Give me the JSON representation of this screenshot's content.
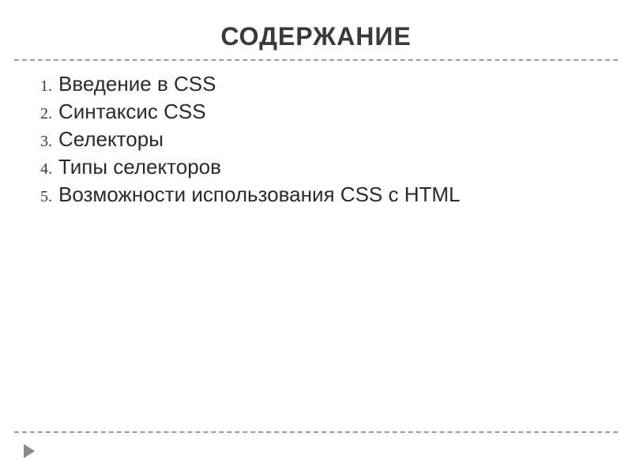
{
  "title": "СОДЕРЖАНИЕ",
  "toc": {
    "items": [
      {
        "num": "1.",
        "text": "Введение в CSS"
      },
      {
        "num": "2.",
        "text": "Синтаксис CSS"
      },
      {
        "num": "3.",
        "text": "Селекторы"
      },
      {
        "num": "4.",
        "text": "Типы селекторов"
      },
      {
        "num": "5.",
        "text": "Возможности использования CSS с HTML"
      }
    ]
  }
}
